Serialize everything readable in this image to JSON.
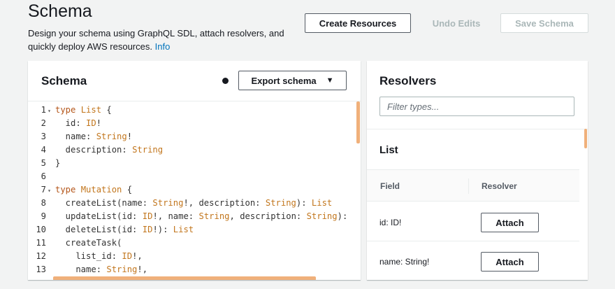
{
  "header": {
    "title": "Schema",
    "description": "Design your schema using GraphQL SDL, attach resolvers, and quickly deploy AWS resources.",
    "info_link": "Info",
    "create_button": "Create Resources",
    "undo_button": "Undo Edits",
    "save_button": "Save Schema"
  },
  "schema_panel": {
    "title": "Schema",
    "export_button": "Export schema",
    "code_lines": [
      {
        "n": "1",
        "fold": true,
        "parts": [
          [
            "kw",
            "type"
          ],
          [
            "ty",
            " List"
          ],
          [
            "",
            " {"
          ]
        ]
      },
      {
        "n": "2",
        "fold": false,
        "parts": [
          [
            "",
            "  id: "
          ],
          [
            "ty",
            "ID"
          ],
          [
            "",
            "!"
          ]
        ]
      },
      {
        "n": "3",
        "fold": false,
        "parts": [
          [
            "",
            "  name: "
          ],
          [
            "ty",
            "String"
          ],
          [
            "",
            "!"
          ]
        ]
      },
      {
        "n": "4",
        "fold": false,
        "parts": [
          [
            "",
            "  description: "
          ],
          [
            "ty",
            "String"
          ]
        ]
      },
      {
        "n": "5",
        "fold": false,
        "parts": [
          [
            "",
            "}"
          ]
        ]
      },
      {
        "n": "6",
        "fold": false,
        "parts": [
          [
            "",
            ""
          ]
        ]
      },
      {
        "n": "7",
        "fold": true,
        "parts": [
          [
            "kw",
            "type"
          ],
          [
            "ty",
            " Mutation"
          ],
          [
            "",
            " {"
          ]
        ]
      },
      {
        "n": "8",
        "fold": false,
        "parts": [
          [
            "",
            "  createList(name: "
          ],
          [
            "ty",
            "String"
          ],
          [
            "",
            "!, description: "
          ],
          [
            "ty",
            "String"
          ],
          [
            "",
            "): "
          ],
          [
            "ty",
            "List"
          ]
        ]
      },
      {
        "n": "9",
        "fold": false,
        "parts": [
          [
            "",
            "  updateList(id: "
          ],
          [
            "ty",
            "ID"
          ],
          [
            "",
            "!, name: "
          ],
          [
            "ty",
            "String"
          ],
          [
            "",
            ", description: "
          ],
          [
            "ty",
            "String"
          ],
          [
            "",
            "):"
          ]
        ]
      },
      {
        "n": "10",
        "fold": false,
        "parts": [
          [
            "",
            "  deleteList(id: "
          ],
          [
            "ty",
            "ID"
          ],
          [
            "",
            "!): "
          ],
          [
            "ty",
            "List"
          ]
        ]
      },
      {
        "n": "11",
        "fold": false,
        "parts": [
          [
            "",
            "  createTask("
          ]
        ]
      },
      {
        "n": "12",
        "fold": false,
        "parts": [
          [
            "",
            "    list_id: "
          ],
          [
            "ty",
            "ID"
          ],
          [
            "",
            "!,"
          ]
        ]
      },
      {
        "n": "13",
        "fold": false,
        "parts": [
          [
            "",
            "    name: "
          ],
          [
            "ty",
            "String"
          ],
          [
            "",
            "!,"
          ]
        ]
      }
    ]
  },
  "resolvers_panel": {
    "title": "Resolvers",
    "filter_placeholder": "Filter types...",
    "type_title": "List",
    "col_field": "Field",
    "col_resolver": "Resolver",
    "rows": [
      {
        "field": "id: ID!",
        "action": "Attach"
      },
      {
        "field": "name: String!",
        "action": "Attach"
      }
    ]
  },
  "colors": {
    "keyword": "#b4561a",
    "type": "#c2761d",
    "link": "#0073bb",
    "scrollbar": "#f0b07a"
  }
}
